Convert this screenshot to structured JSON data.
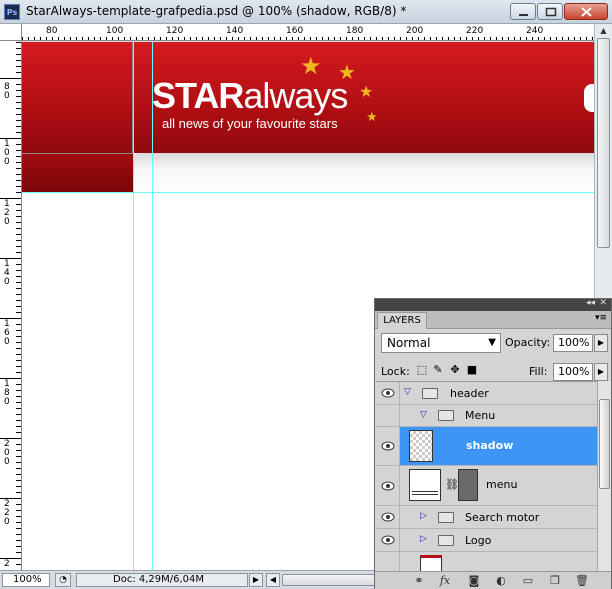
{
  "window": {
    "title": "StarAlways-template-grafpedia.psd @ 100% (shadow, RGB/8) *",
    "app_icon": "Ps"
  },
  "ruler_top": [
    "80",
    "100",
    "120",
    "140",
    "160",
    "180",
    "200",
    "220",
    "240"
  ],
  "ruler_left": [
    "80",
    "100",
    "120",
    "140",
    "160",
    "180",
    "200",
    "220",
    "2"
  ],
  "artwork": {
    "logo_bold": "STAR",
    "logo_rest": "always",
    "tagline": "all news of your favourite stars",
    "accent_color": "#d41a1f",
    "star_color": "#f3b61d",
    "guide_color": "#66ffff"
  },
  "status": {
    "zoom": "100%",
    "doc": "Doc: 4,29M/6,04M"
  },
  "layers_panel": {
    "tab": "LAYERS",
    "blend_mode": "Normal",
    "opacity_label": "Opacity:",
    "opacity": "100%",
    "lock_label": "Lock:",
    "fill_label": "Fill:",
    "fill": "100%",
    "layers": [
      {
        "name": "header",
        "type": "group",
        "expanded": true,
        "visible": true
      },
      {
        "name": "Menu",
        "type": "group",
        "expanded": true,
        "visible": false
      },
      {
        "name": "shadow",
        "type": "layer",
        "selected": true,
        "visible": true
      },
      {
        "name": "menu",
        "type": "layer-mask",
        "visible": true
      },
      {
        "name": "Search motor",
        "type": "group",
        "expanded": false,
        "visible": true
      },
      {
        "name": "Logo",
        "type": "group",
        "expanded": false,
        "visible": true
      }
    ],
    "footer_icons": [
      "link-icon",
      "fx-icon",
      "mask-icon",
      "adjustment-icon",
      "folder-icon",
      "new-layer-icon",
      "trash-icon"
    ],
    "selection_color": "#3d95f5"
  }
}
